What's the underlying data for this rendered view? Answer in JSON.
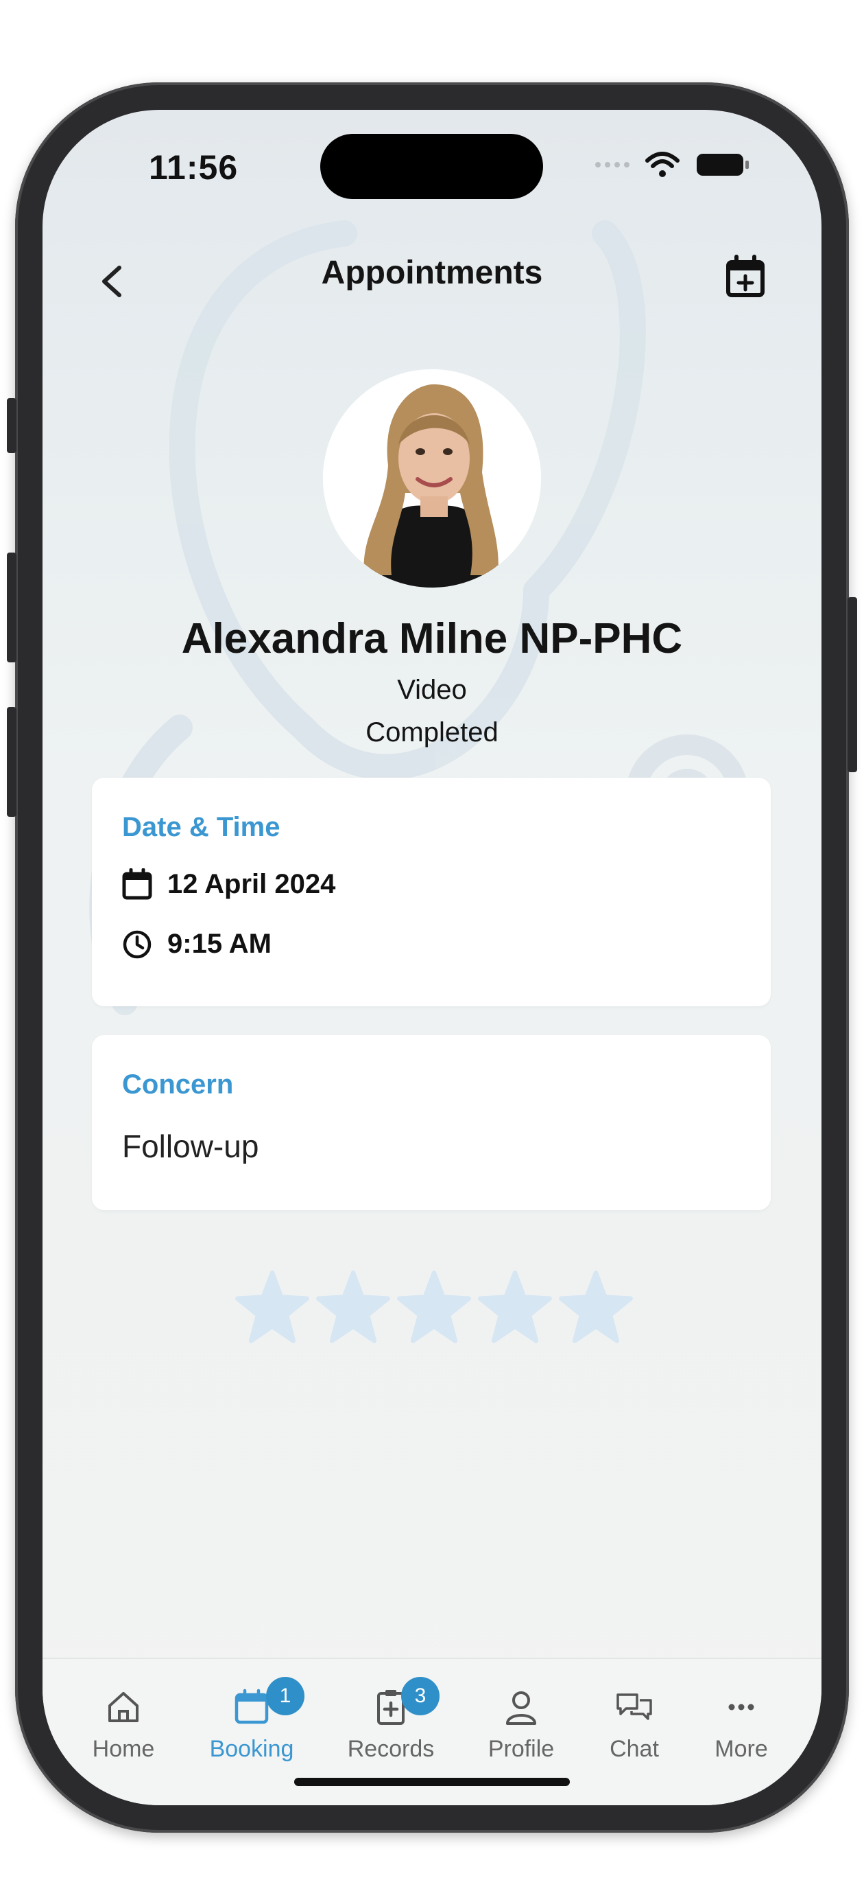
{
  "status_bar": {
    "time": "11:56"
  },
  "header": {
    "title": "Appointments"
  },
  "provider": {
    "name": "Alexandra Milne NP-PHC",
    "visit_type": "Video",
    "status": "Completed"
  },
  "date_time_card": {
    "title": "Date & Time",
    "date": "12 April 2024",
    "time": "9:15 AM"
  },
  "concern_card": {
    "title": "Concern",
    "value": "Follow-up"
  },
  "rating": {
    "value": 0,
    "max": 5
  },
  "tabs": [
    {
      "label": "Home",
      "icon": "home-icon"
    },
    {
      "label": "Booking",
      "icon": "calendar-icon",
      "badge": "1",
      "active": true
    },
    {
      "label": "Records",
      "icon": "clipboard-plus-icon",
      "badge": "3"
    },
    {
      "label": "Profile",
      "icon": "user-icon"
    },
    {
      "label": "Chat",
      "icon": "chat-icon"
    },
    {
      "label": "More",
      "icon": "more-icon"
    }
  ],
  "colors": {
    "accent": "#3a97d1",
    "badge": "#2f8fc8",
    "star": "#d6e6f2"
  }
}
